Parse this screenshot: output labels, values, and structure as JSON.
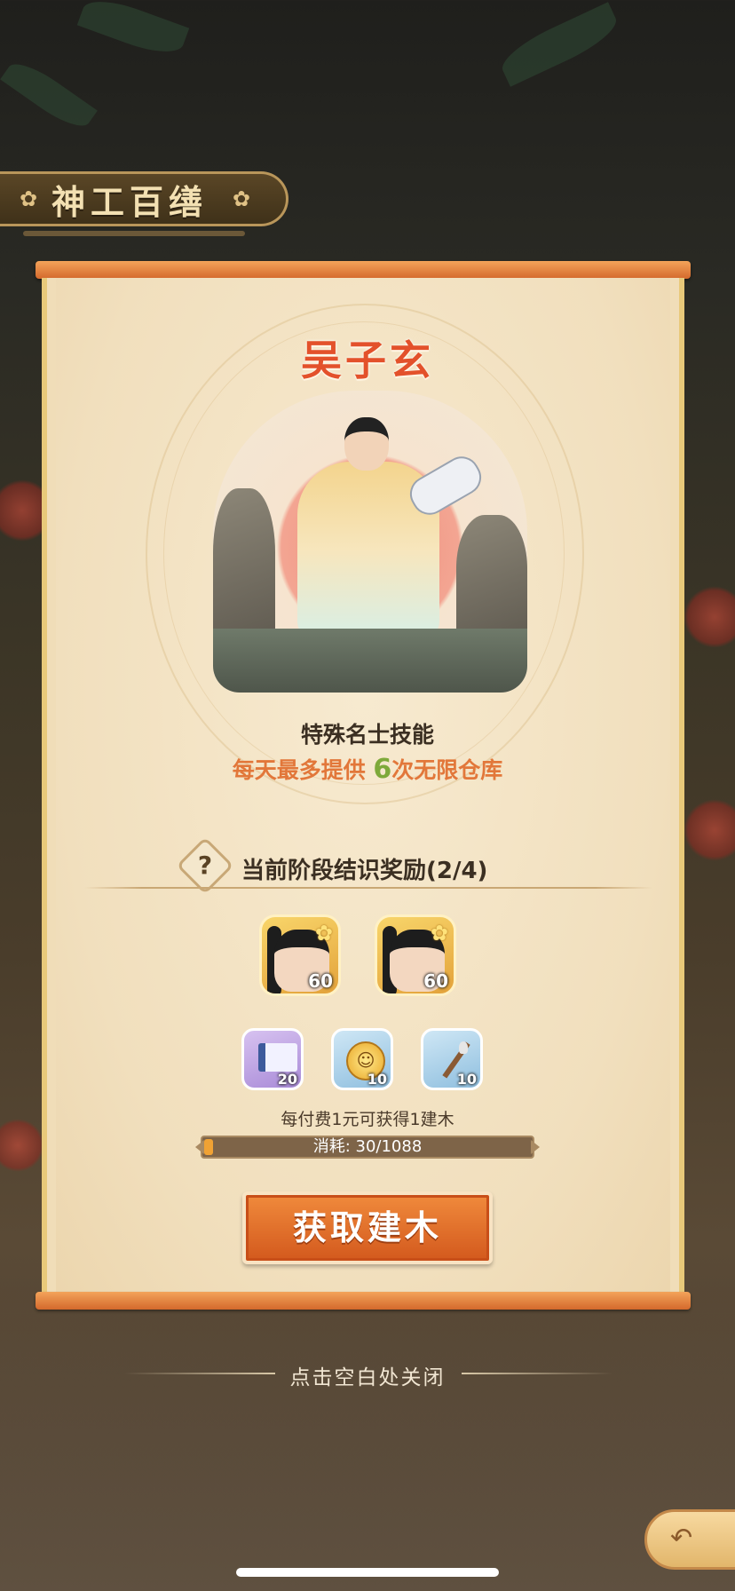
{
  "header": {
    "title": "神工百缮"
  },
  "hero": {
    "name": "吴子玄",
    "skill_title": "特殊名士技能",
    "skill_desc_prefix": "每天最多提供",
    "skill_desc_number": "6",
    "skill_desc_suffix": "次无限仓库"
  },
  "stage": {
    "help_icon": "?",
    "title": "当前阶段结识奖励(2/4)"
  },
  "rewards": {
    "heroes": [
      {
        "icon": "hero-portrait-icon",
        "count": "60"
      },
      {
        "icon": "hero-portrait-icon",
        "count": "60"
      }
    ],
    "items": [
      {
        "icon": "book-icon",
        "count": "20"
      },
      {
        "icon": "coin-icon",
        "count": "10"
      },
      {
        "icon": "brush-icon",
        "count": "10"
      }
    ]
  },
  "purchase": {
    "note": "每付费1元可获得1建木",
    "progress_label": "消耗: 30/1088",
    "progress_fraction": 0.028,
    "button_label": "获取建木"
  },
  "footer": {
    "close_hint": "点击空白处关闭",
    "back_icon": "back-arrow-icon"
  },
  "colors": {
    "accent": "#e3512b",
    "button": "#d3591d",
    "highlight_number": "#7ea93a"
  }
}
